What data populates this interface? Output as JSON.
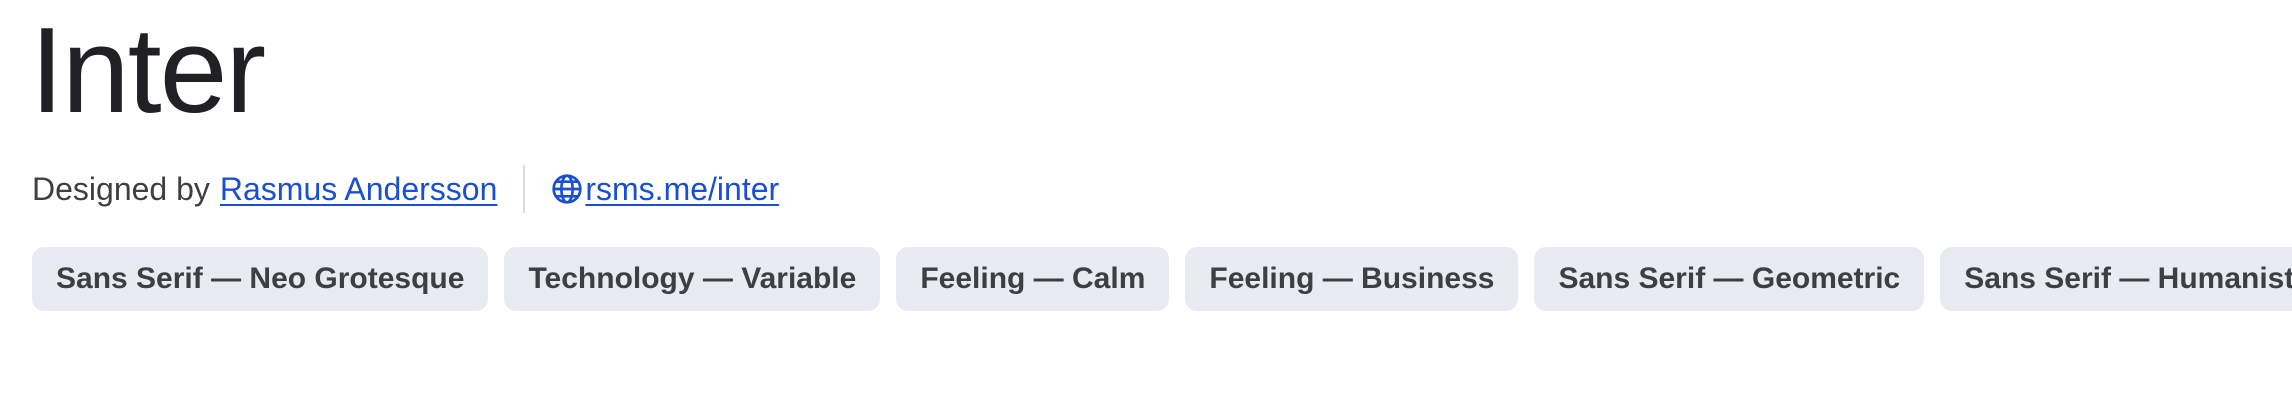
{
  "font": {
    "name": "Inter",
    "designer_prefix": "Designed by",
    "designer_name": "Rasmus Andersson",
    "website": "rsms.me/inter",
    "website_icon": "globe-icon"
  },
  "tags": [
    "Sans Serif — Neo Grotesque",
    "Technology — Variable",
    "Feeling — Calm",
    "Feeling — Business",
    "Sans Serif — Geometric",
    "Sans Serif — Humanist"
  ],
  "colors": {
    "title": "#202124",
    "text": "#3c4043",
    "link": "#1a4fd1",
    "tag_background": "#e8ebf2",
    "divider": "#dadce0"
  }
}
